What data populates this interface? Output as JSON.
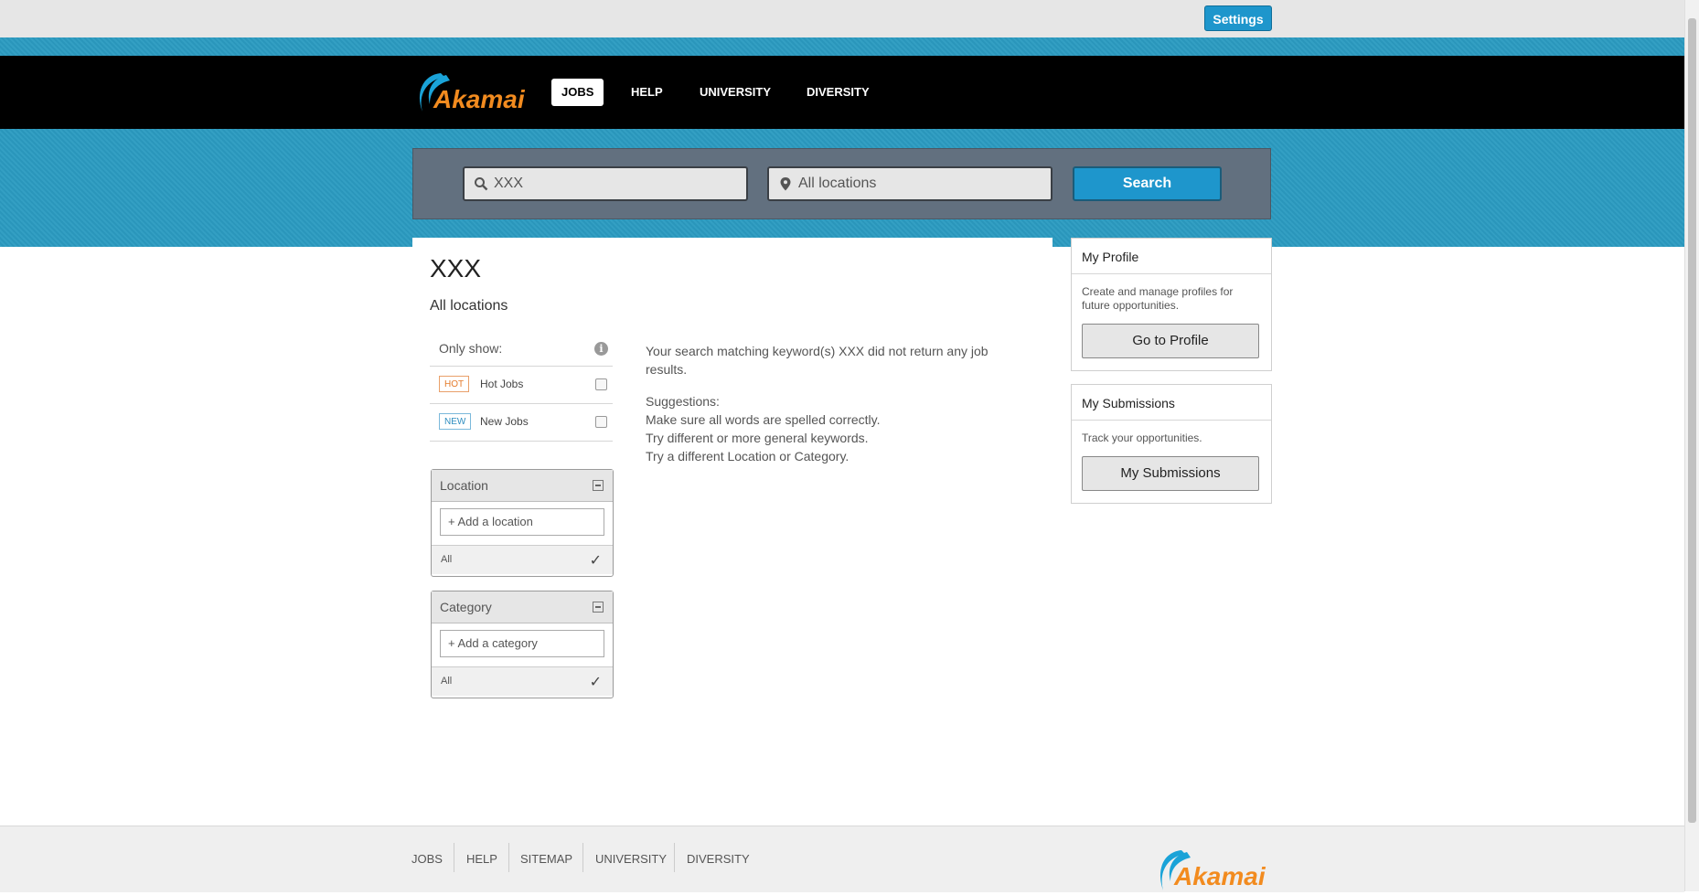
{
  "topbar": {
    "settings_label": "Settings"
  },
  "nav": {
    "logo_text": "Akamai",
    "items": [
      {
        "label": "JOBS",
        "active": true
      },
      {
        "label": "HELP",
        "active": false
      },
      {
        "label": "UNIVERSITY",
        "active": false
      },
      {
        "label": "DIVERSITY",
        "active": false
      }
    ]
  },
  "search": {
    "keyword_value": "XXX",
    "location_value": "All locations",
    "button_label": "Search"
  },
  "results": {
    "title": "XXX",
    "subtitle": "All locations",
    "message_line1": "Your search matching keyword(s) XXX did not return any job",
    "message_line2": "results.",
    "suggestions_heading": "Suggestions:",
    "suggestions": [
      "Make sure all words are spelled correctly.",
      "Try different or more general keywords.",
      "Try a different Location or Category."
    ]
  },
  "filters": {
    "only_show_label": "Only show:",
    "hot": {
      "tag": "HOT",
      "label": "Hot Jobs",
      "checked": false
    },
    "new": {
      "tag": "NEW",
      "label": "New Jobs",
      "checked": false
    }
  },
  "facets": {
    "location": {
      "title": "Location",
      "add_label": "+ Add a location",
      "all_label": "All"
    },
    "category": {
      "title": "Category",
      "add_label": "+ Add a category",
      "all_label": "All"
    }
  },
  "sidebar": {
    "profile": {
      "title": "My Profile",
      "description": "Create and manage profiles for future opportunities.",
      "button_label": "Go to Profile"
    },
    "submissions": {
      "title": "My Submissions",
      "description": "Track your opportunities.",
      "button_label": "My Submissions"
    }
  },
  "footer": {
    "links": [
      "JOBS",
      "HELP",
      "SITEMAP",
      "UNIVERSITY",
      "DIVERSITY"
    ],
    "logo_text": "Akamai"
  },
  "colors": {
    "accent": "#1e96cc",
    "hero": "#2b9bc1",
    "navbar": "#000000",
    "logo_orange": "#f28b1f",
    "logo_blue": "#0099cc"
  }
}
